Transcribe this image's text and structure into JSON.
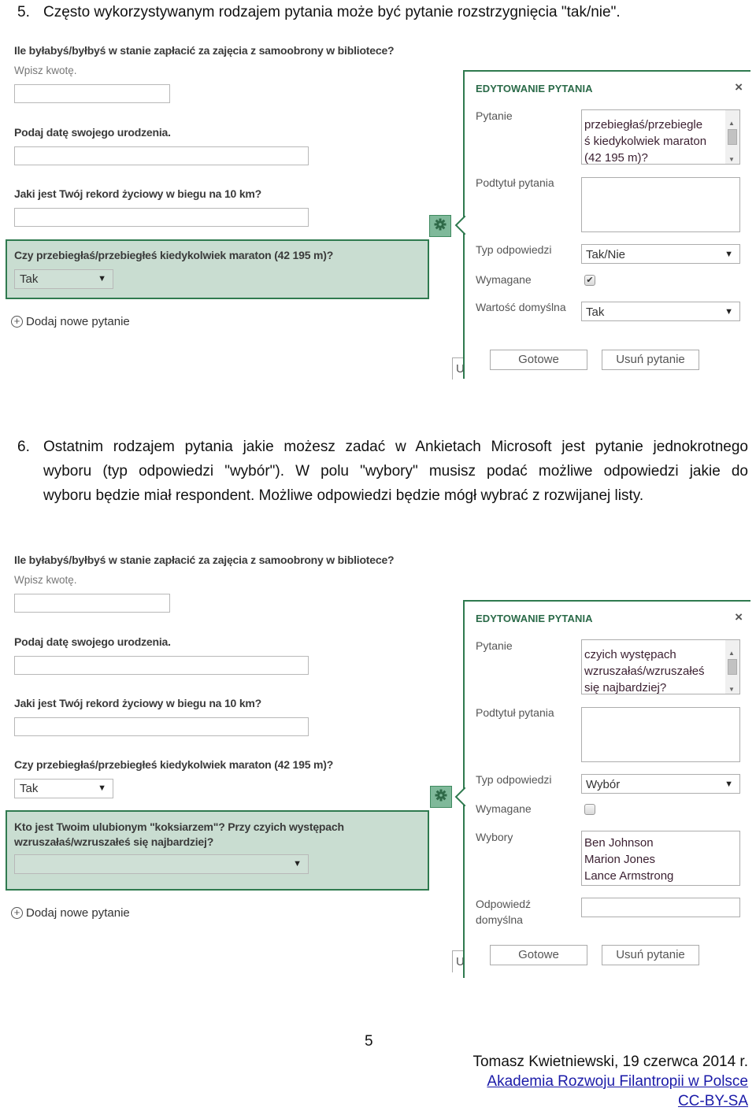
{
  "items": [
    {
      "number": "5.",
      "text": "Często wykorzystywanym rodzajem pytania może być pytanie rozstrzygnięcia \"tak/nie\"."
    },
    {
      "number": "6.",
      "lines": [
        "Ostatnim rodzajem pytania jakie możesz zadać w Ankietach Microsoft jest pytanie jednokrotnego",
        "wyboru (typ odpowiedzi \"wybór\"). W polu \"wybory\" musisz podać możliwe odpowiedzi jakie do",
        "wyboru będzie miał respondent. Możliwe odpowiedzi będzie mógł wybrać z rozwijanej listy."
      ]
    }
  ],
  "screenshot1": {
    "questions": [
      {
        "title": "Ile byłabyś/byłbyś w stanie zapłacić za zajęcia z samoobrony w bibliotece?",
        "subtitle": "Wpisz kwotę."
      },
      {
        "title": "Podaj datę swojego urodzenia."
      },
      {
        "title": "Jaki jest Twój rekord życiowy w biegu na 10 km?"
      },
      {
        "title": "Czy przebiegłaś/przebiegłeś kiedykolwiek maraton (42 195 m)?",
        "select_value": "Tak"
      }
    ],
    "add_question": "Dodaj nowe pytanie",
    "panel": {
      "title": "EDYTOWANIE PYTANIA",
      "close": "×",
      "question_label": "Pytanie",
      "question_lines": [
        "przebiegłaś/przebiegle",
        "ś kiedykolwiek maraton",
        "(42 195 m)?"
      ],
      "subtitle_label": "Podtytuł pytania",
      "subtitle_value": "",
      "type_label": "Typ odpowiedzi",
      "type_value": "Tak/Nie",
      "required_label": "Wymagane",
      "required_checked": true,
      "default_label": "Wartość domyślna",
      "default_value": "Tak",
      "done_button": "Gotowe",
      "delete_button": "Usuń pytanie"
    },
    "partial_button": "U"
  },
  "screenshot2": {
    "questions": [
      {
        "title": "Ile byłabyś/byłbyś w stanie zapłacić za zajęcia z samoobrony w bibliotece?",
        "subtitle": "Wpisz kwotę."
      },
      {
        "title": "Podaj datę swojego urodzenia."
      },
      {
        "title": "Jaki jest Twój rekord życiowy w biegu na 10 km?"
      },
      {
        "title": "Czy przebiegłaś/przebiegłeś kiedykolwiek maraton (42 195 m)?",
        "select_value": "Tak"
      },
      {
        "title_lines": [
          "Kto jest Twoim ulubionym \"koksiarzem\"? Przy czyich występach",
          "wzruszałaś/wzruszałeś się najbardziej?"
        ],
        "select_value": ""
      }
    ],
    "add_question": "Dodaj nowe pytanie",
    "panel": {
      "title": "EDYTOWANIE PYTANIA",
      "close": "×",
      "question_label": "Pytanie",
      "question_lines": [
        "czyich występach",
        "wzruszałaś/wzruszałeś",
        "się najbardziej?"
      ],
      "subtitle_label": "Podtytuł pytania",
      "subtitle_value": "",
      "type_label": "Typ odpowiedzi",
      "type_value": "Wybór",
      "required_label": "Wymagane",
      "required_checked": false,
      "choices_label": "Wybory",
      "choices": [
        "Ben Johnson",
        "Marion Jones",
        "Lance Armstrong"
      ],
      "default_label_lines": [
        "Odpowiedź",
        "domyślna"
      ],
      "default_value": "",
      "done_button": "Gotowe",
      "delete_button": "Usuń pytanie"
    },
    "partial_button": "U"
  },
  "footer": {
    "page_number": "5",
    "author_date": "Tomasz Kwietniewski, 19 czerwca 2014 r.",
    "org_link": "Akademia Rozwoju Filantropii w Polsce",
    "license_link": "CC-BY-SA"
  },
  "colors": {
    "accent_green": "#2f7a4f",
    "selected_bg": "#c9ddd1",
    "link": "#1a1aa8"
  }
}
